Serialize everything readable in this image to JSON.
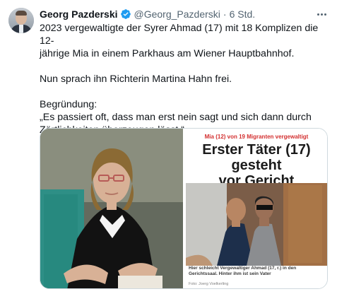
{
  "tweet": {
    "author_name": "Georg Pazderski",
    "handle": "@Georg_Pazderski",
    "separator": "·",
    "time": "6 Std.",
    "paragraphs": [
      [
        "2023 vergewaltigte der Syrer Ahmad (17) mit 18 Komplizen die 12-",
        "jährige Mia in einem Parkhaus am Wiener Hauptbahnhof."
      ],
      [
        "Nun sprach ihn Richterin Martina Hahn frei."
      ],
      [
        "Begründung:",
        "„Es passiert oft, dass man erst nein sagt und sich dann durch",
        "Zärtlichkeiten überzeugen lässt.“"
      ]
    ]
  },
  "media": {
    "right_article": {
      "kicker": "Mia (12) von 19 Migranten vergewaltigt",
      "headline_line1": "Erster Täter (17) gesteht",
      "headline_line2": "vor Gericht",
      "caption_line1": "Hier schleicht Vergewaltiger Ahmad (17, r.) in den",
      "caption_line2": "Gerichtssaal. Hinter ihm ist sein Vater",
      "credit": "Foto: Joerg Voelkerling"
    }
  },
  "icons": {
    "verified": "verified-badge-icon",
    "more": "more-options-icon"
  },
  "colors": {
    "text": "#0f1419",
    "muted": "#536471",
    "verified": "#1d9bf0",
    "headline_red": "#d32f2f"
  }
}
